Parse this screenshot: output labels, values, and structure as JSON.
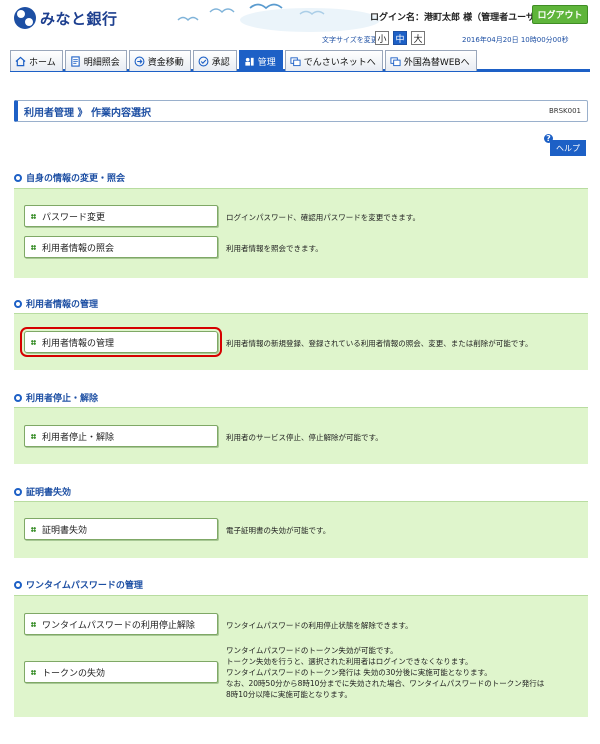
{
  "header": {
    "bank_name": "みなと銀行",
    "login_name": "ログイン名：港町太郎 様（管理者ユーザ）",
    "logout_label": "ログアウト",
    "font_size_label": "文字サイズを変更",
    "font_sizes": [
      "小",
      "中",
      "大"
    ],
    "datetime": "2016年04月20日 10時00分00秒"
  },
  "nav": {
    "tabs": [
      {
        "label": "ホーム",
        "icon": "home-icon"
      },
      {
        "label": "明細照会",
        "icon": "document-icon"
      },
      {
        "label": "資金移動",
        "icon": "transfer-icon"
      },
      {
        "label": "承認",
        "icon": "check-icon"
      },
      {
        "label": "管理",
        "icon": "manage-icon",
        "active": true
      },
      {
        "label": "でんさいネットへ",
        "icon": "window-icon"
      },
      {
        "label": "外国為替WEBへ",
        "icon": "window-icon"
      }
    ]
  },
  "page": {
    "title": "利用者管理 》 作業内容選択",
    "screen_id": "BRSK001",
    "help_label": "ヘルプ",
    "help_q": "?"
  },
  "sections": [
    {
      "heading": "自身の情報の変更・照会",
      "items": [
        {
          "label": "パスワード変更",
          "desc": "ログインパスワード、確認用パスワードを変更できます。"
        },
        {
          "label": "利用者情報の照会",
          "desc": "利用者情報を照会できます。"
        }
      ]
    },
    {
      "heading": "利用者情報の管理",
      "items": [
        {
          "label": "利用者情報の管理",
          "desc": "利用者情報の新規登録、登録されている利用者情報の照会、変更、または削除が可能です。",
          "selected": true
        }
      ]
    },
    {
      "heading": "利用者停止・解除",
      "items": [
        {
          "label": "利用者停止・解除",
          "desc": "利用者のサービス停止、停止解除が可能です。"
        }
      ]
    },
    {
      "heading": "証明書失効",
      "items": [
        {
          "label": "証明書失効",
          "desc": "電子証明書の失効が可能です。"
        }
      ]
    },
    {
      "heading": "ワンタイムパスワードの管理",
      "items": [
        {
          "label": "ワンタイムパスワードの利用停止解除",
          "desc": "ワンタイムパスワードの利用停止状態を解除できます。"
        },
        {
          "label": "トークンの失効",
          "desc_lines": [
            "ワンタイムパスワードのトークン失効が可能です。",
            "トークン失効を行うと、選択された利用者はログインできなくなります。",
            "ワンタイムパスワードのトークン発行は 失効の30分後に実施可能となります。",
            "なお、20時50分から8時10分までに失効された場合、ワンタイムパスワードのトークン発行は",
            "8時10分以降に実施可能となります。"
          ]
        }
      ]
    }
  ],
  "colors": {
    "accent_blue": "#1d60c6",
    "section_bg": "#dff5cc",
    "logout_green": "#5fb53b",
    "selected_outline": "#d60000"
  }
}
